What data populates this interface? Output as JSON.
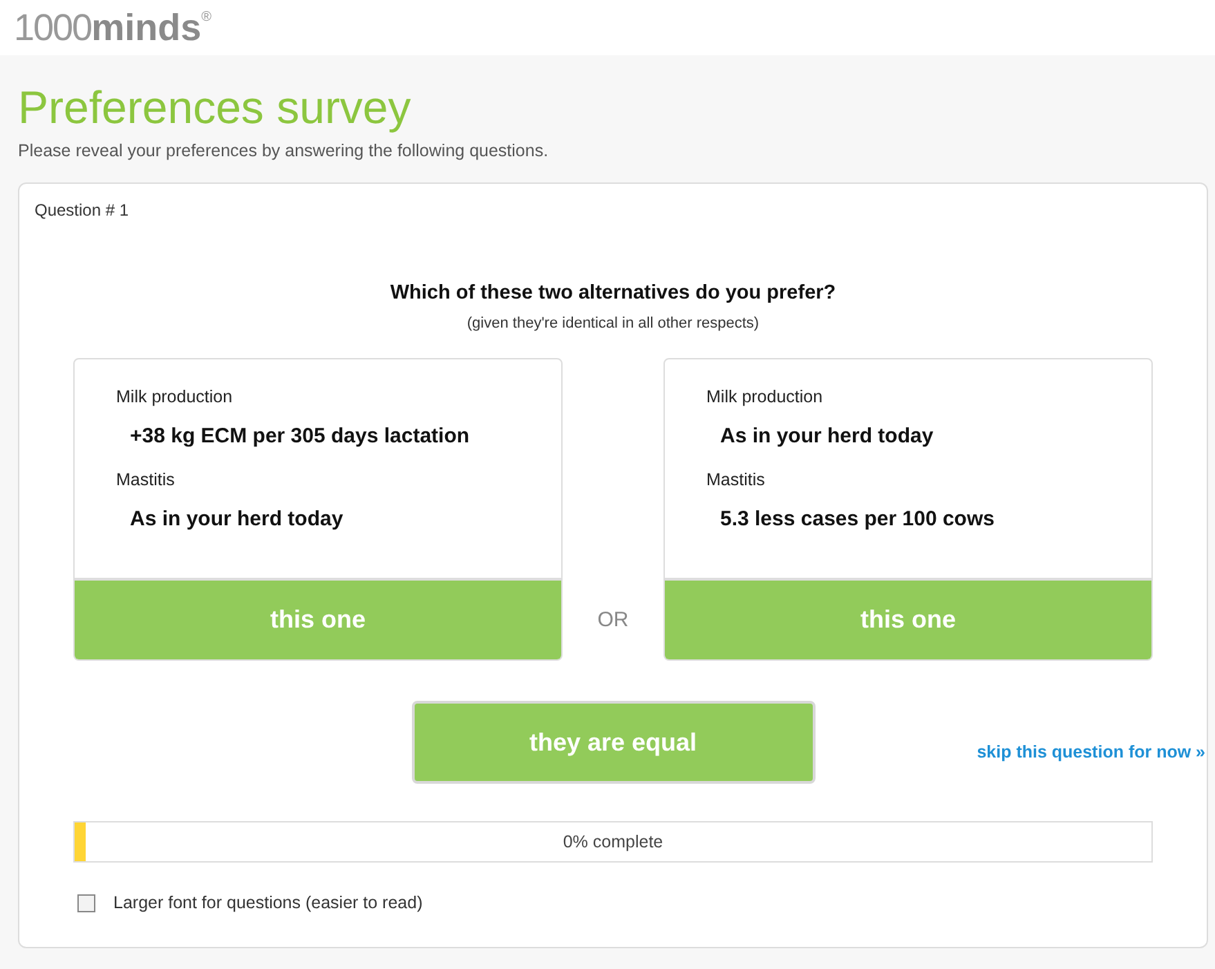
{
  "logo": {
    "light": "1000",
    "bold": "minds",
    "mark": "®"
  },
  "title": "Preferences survey",
  "subtitle": "Please reveal your preferences by answering the following questions.",
  "question": {
    "label": "Question # 1",
    "prompt": "Which of these two alternatives do you prefer?",
    "note": "(given they're identical in all other respects)",
    "alternatives": [
      {
        "criteria": [
          {
            "name": "Milk production",
            "value": "+38 kg ECM per 305 days lactation"
          },
          {
            "name": "Mastitis",
            "value": "As in your herd today"
          }
        ],
        "button": "this one"
      },
      {
        "criteria": [
          {
            "name": "Milk production",
            "value": "As in your herd today"
          },
          {
            "name": "Mastitis",
            "value": "5.3 less cases per 100 cows"
          }
        ],
        "button": "this one"
      }
    ],
    "separator": "OR",
    "equal_button": "they are equal",
    "skip_link": "skip this question for now »"
  },
  "progress": {
    "level": 0.01,
    "label": "0% complete"
  },
  "larger_font": {
    "label": "Larger font for questions (easier to read)",
    "checked": false
  }
}
